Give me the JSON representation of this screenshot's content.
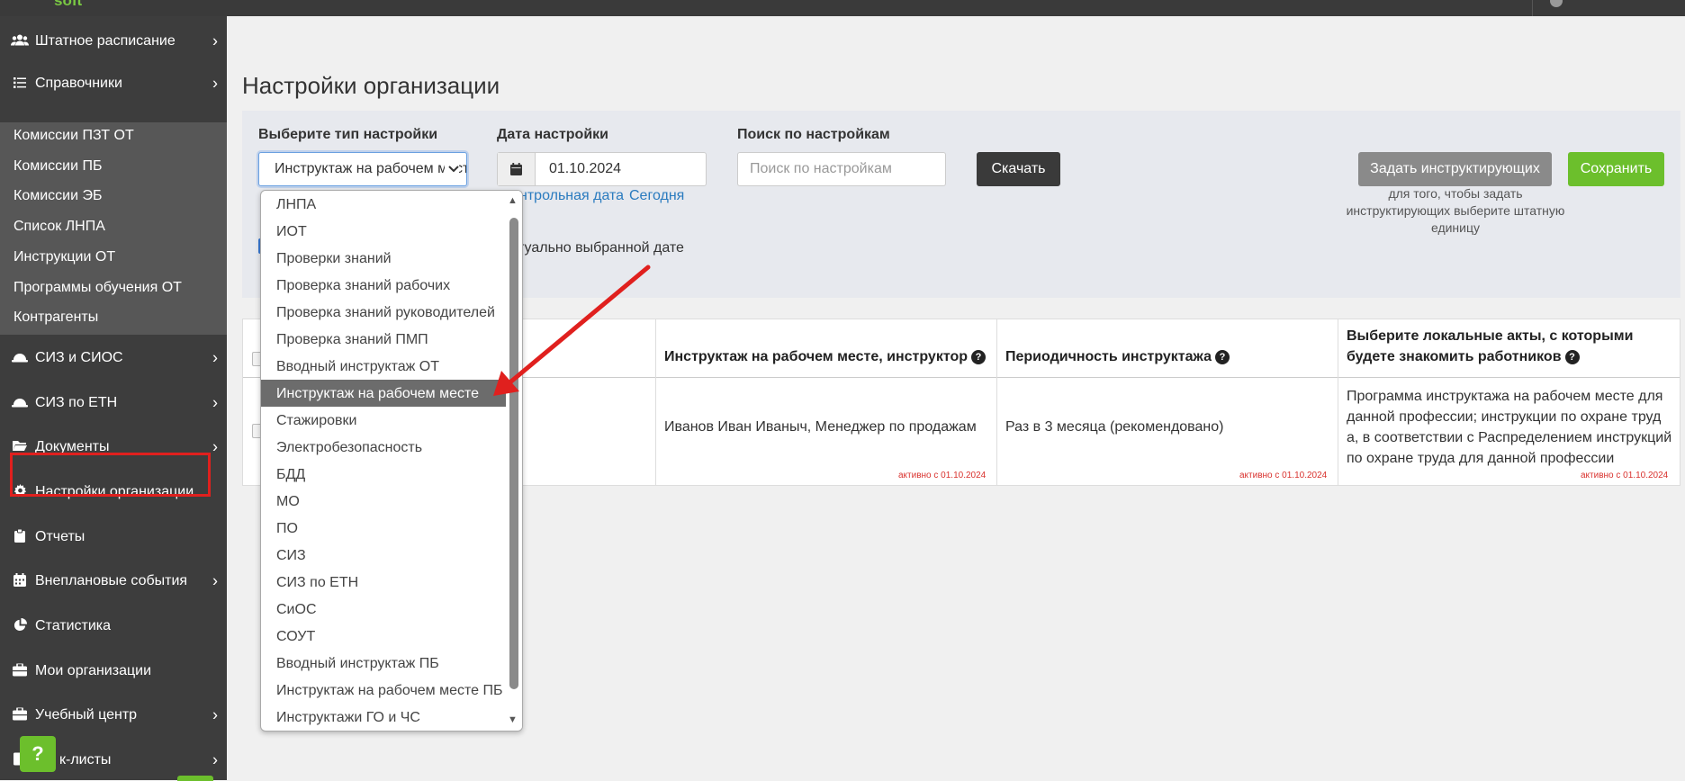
{
  "header": {
    "logo": "soft"
  },
  "sidebar": {
    "items": [
      {
        "icon": "users-icon",
        "label": "Штатное расписание",
        "chevron": true
      },
      {
        "icon": "list-icon",
        "label": "Справочники",
        "chevron": true
      },
      {
        "icon": "helmet-icon",
        "label": "СИЗ и СИОС",
        "chevron": true
      },
      {
        "icon": "helmet-icon",
        "label": "СИЗ по ЕТН",
        "chevron": true
      },
      {
        "icon": "folder-icon",
        "label": "Документы",
        "chevron": true
      },
      {
        "icon": "gear-icon",
        "label": "Настройки организации",
        "chevron": false
      },
      {
        "icon": "clipboard-icon",
        "label": "Отчеты",
        "chevron": false
      },
      {
        "icon": "calendar-icon",
        "label": "Внеплановые события",
        "chevron": true
      },
      {
        "icon": "pie-chart-icon",
        "label": "Статистика",
        "chevron": false
      },
      {
        "icon": "briefcase-icon",
        "label": "Мои организации",
        "chevron": false
      },
      {
        "icon": "graduation-icon",
        "label": "Учебный центр",
        "chevron": true
      },
      {
        "icon": "checklist-icon",
        "label": "к-листы",
        "chevron": true
      }
    ],
    "subitems": [
      "Комиссии ПЗТ ОТ",
      "Комиссии ПБ",
      "Комиссии ЭБ",
      "Список ЛНПА",
      "Инструкции ОТ",
      "Программы обучения ОТ",
      "Контрагенты"
    ],
    "help_label": "?"
  },
  "page": {
    "title": "Настройки организации"
  },
  "filters": {
    "type_label": "Выберите тип настройки",
    "type_value": "Инструктаж на рабочем месте",
    "date_label": "Дата настройки",
    "date_value": "01.10.2024",
    "date_link_control": "нтрольная дата",
    "date_link_today": "Сегодня",
    "search_label": "Поиск по настройкам",
    "search_placeholder": "Поиск по настройкам",
    "download_button": "Скачать",
    "set_instructors_button": "Задать инструктирующих",
    "save_button": "Сохранить",
    "instructors_hint": "для того, чтобы задать инструктирующих выберите штатную единицу",
    "checkbox_text": "туально выбранной дате"
  },
  "dropdown": {
    "options": [
      "ЛНПА",
      "ИОТ",
      "Проверки знаний",
      "Проверка знаний рабочих",
      "Проверка знаний руководителей",
      "Проверка знаний ПМП",
      "Вводный инструктаж ОТ",
      "Инструктаж на рабочем месте",
      "Стажировки",
      "Электробезопасность",
      "БДД",
      "МО",
      "ПО",
      "СИЗ",
      "СИЗ по ЕТН",
      "СиОС",
      "СОУТ",
      "Вводный инструктаж ПБ",
      "Инструктаж на рабочем месте ПБ",
      "Инструктажи ГО и ЧС"
    ],
    "selected_index": 7
  },
  "table": {
    "columns": [
      "Инструктаж на рабочем месте, инструктор",
      "Периодичность инструктажа",
      "Выберите локальные акты, с которыми будете знакомить работников"
    ],
    "rows": [
      {
        "instructor": "Иванов Иван Иваныч, Менеджер по продажам",
        "periodicity": "Раз в 3 месяца (рекомендовано)",
        "acts": "Программа инструктажа на рабочем месте для данной профессии; инструкции по охране труда, в соответствии с Распределением инструкций по охране труда для данной профессии",
        "active_label": "активно с 01.10.2024"
      }
    ]
  },
  "colors": {
    "sidebar_bg": "#3d3d3d",
    "accent_green": "#6cbf2c",
    "highlight_red": "#e0201e",
    "link_blue": "#2a7bbf"
  }
}
